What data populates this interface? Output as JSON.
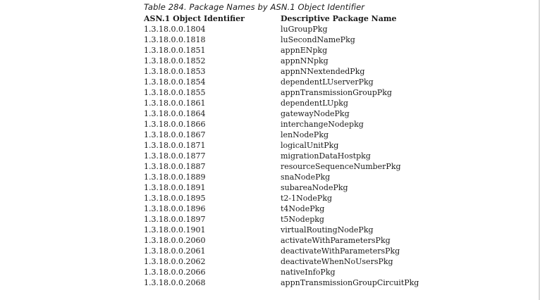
{
  "caption": "Table 284. Package Names by ASN.1 Object Identifier",
  "table": {
    "headers": [
      "ASN.1 Object Identifier",
      "Descriptive Package Name"
    ],
    "rows": [
      [
        "1.3.18.0.0.1804",
        "luGroupPkg"
      ],
      [
        "1.3.18.0.0.1818",
        "luSecondNamePkg"
      ],
      [
        "1.3.18.0.0.1851",
        "appnENpkg"
      ],
      [
        "1.3.18.0.0.1852",
        "appnNNpkg"
      ],
      [
        "1.3.18.0.0.1853",
        "appnNNextendedPkg"
      ],
      [
        "1.3.18.0.0.1854",
        "dependentLUserverPkg"
      ],
      [
        "1.3.18.0.0.1855",
        "appnTransmissionGroupPkg"
      ],
      [
        "1.3.18.0.0.1861",
        "dependentLUpkg"
      ],
      [
        "1.3.18.0.0.1864",
        "gatewayNodePkg"
      ],
      [
        "1.3.18.0.0.1866",
        "interchangeNodepkg"
      ],
      [
        "1.3.18.0.0.1867",
        "lenNodePkg"
      ],
      [
        "1.3.18.0.0.1871",
        "logicalUnitPkg"
      ],
      [
        "1.3.18.0.0.1877",
        "migrationDataHostpkg"
      ],
      [
        "1.3.18.0.0.1887",
        "resourceSequenceNumberPkg"
      ],
      [
        "1.3.18.0.0.1889",
        "snaNodePkg"
      ],
      [
        "1.3.18.0.0.1891",
        "subareaNodePkg"
      ],
      [
        "1.3.18.0.0.1895",
        "t2-1NodePkg"
      ],
      [
        "1.3.18.0.0.1896",
        "t4NodePkg"
      ],
      [
        "1.3.18.0.0.1897",
        "t5Nodepkg"
      ],
      [
        "1.3.18.0.0.1901",
        "virtualRoutingNodePkg"
      ],
      [
        "1.3.18.0.0.2060",
        "activateWithParametersPkg"
      ],
      [
        "1.3.18.0.0.2061",
        "deactivateWithParametersPkg"
      ],
      [
        "1.3.18.0.0.2062",
        "deactivateWhenNoUsersPkg"
      ],
      [
        "1.3.18.0.0.2066",
        "nativeInfoPkg"
      ],
      [
        "1.3.18.0.0.2068",
        "appnTransmissionGroupCircuitPkg"
      ]
    ]
  }
}
